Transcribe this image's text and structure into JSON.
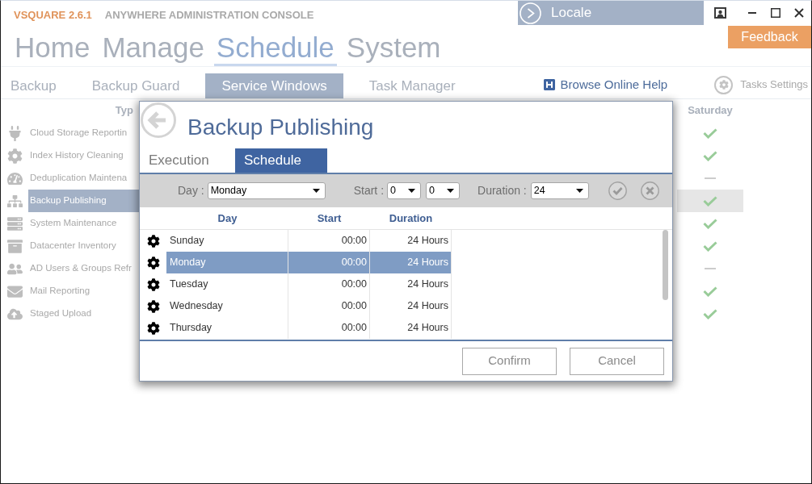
{
  "header": {
    "product": "VSQUARE 2.6.1",
    "subtitle": "ANYWHERE ADMINISTRATION CONSOLE",
    "locale": "Locale",
    "feedback": "Feedback"
  },
  "main_nav": [
    {
      "label": "Home",
      "selected": false
    },
    {
      "label": "Manage",
      "selected": false
    },
    {
      "label": "Schedule",
      "selected": true
    },
    {
      "label": "System",
      "selected": false
    }
  ],
  "sub_tabs": [
    {
      "label": "Backup",
      "selected": false
    },
    {
      "label": "Backup Guard",
      "selected": false
    },
    {
      "label": "Service Windows",
      "selected": true
    },
    {
      "label": "Task Manager",
      "selected": false
    }
  ],
  "help_link": "Browse Online Help",
  "tasks_settings": "Tasks Settings",
  "task_table": {
    "columns": [
      "Typ",
      "Saturday"
    ],
    "rows": [
      {
        "name": "Cloud Storage Reportin",
        "selected": false,
        "saturday": true
      },
      {
        "name": "Index History Cleaning",
        "selected": false,
        "saturday": true
      },
      {
        "name": "Deduplication Maintena",
        "selected": false,
        "saturday": false
      },
      {
        "name": "Backup Publishing",
        "selected": true,
        "saturday": true
      },
      {
        "name": "System Maintenance",
        "selected": false,
        "saturday": true
      },
      {
        "name": "Datacenter Inventory",
        "selected": false,
        "saturday": true
      },
      {
        "name": "AD Users & Groups Refr",
        "selected": false,
        "saturday": false
      },
      {
        "name": "Mail Reporting",
        "selected": false,
        "saturday": true
      },
      {
        "name": "Staged Upload",
        "selected": false,
        "saturday": true
      }
    ]
  },
  "dialog": {
    "title": "Backup Publishing",
    "tabs": [
      {
        "label": "Execution",
        "selected": false
      },
      {
        "label": "Schedule",
        "selected": true
      }
    ],
    "toolbar": {
      "day_label": "Day :",
      "day": "Monday",
      "start_label": "Start :",
      "start_hour": "0",
      "start_minute": "0",
      "duration_label": "Duration :",
      "duration": "24"
    },
    "grid": {
      "columns": [
        "Day",
        "Start",
        "Duration"
      ],
      "rows": [
        {
          "day": "Sunday",
          "start": "00:00",
          "duration": "24 Hours",
          "selected": false
        },
        {
          "day": "Monday",
          "start": "00:00",
          "duration": "24 Hours",
          "selected": true
        },
        {
          "day": "Tuesday",
          "start": "00:00",
          "duration": "24 Hours",
          "selected": false
        },
        {
          "day": "Wednesday",
          "start": "00:00",
          "duration": "24 Hours",
          "selected": false
        },
        {
          "day": "Thursday",
          "start": "00:00",
          "duration": "24 Hours",
          "selected": false
        }
      ]
    },
    "buttons": [
      "Confirm",
      "Cancel"
    ]
  }
}
